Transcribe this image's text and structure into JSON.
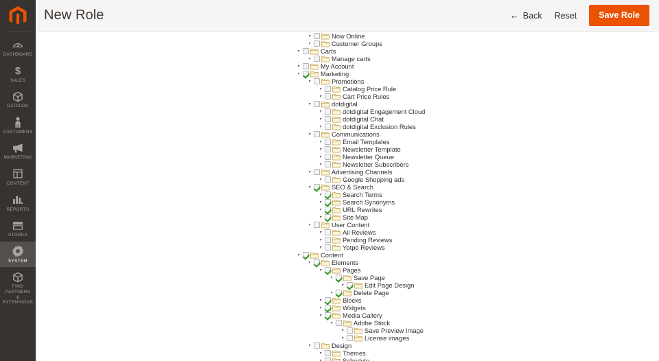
{
  "header": {
    "title": "New Role",
    "back_label": "Back",
    "back_icon": "arrow-left-icon",
    "reset_label": "Reset",
    "save_label": "Save Role",
    "accent_color": "#eb5202",
    "background_color": "#f5f5f5"
  },
  "sidebar": {
    "logo_icon": "magento-logo-icon",
    "logo_color": "#eb5202",
    "background_color": "#373330",
    "active_background_color": "#55504c",
    "items": [
      {
        "label": "Dashboard",
        "icon": "dashboard-icon",
        "active": false
      },
      {
        "label": "Sales",
        "icon": "dollar-icon",
        "active": false
      },
      {
        "label": "Catalog",
        "icon": "box-icon",
        "active": false
      },
      {
        "label": "Customers",
        "icon": "person-icon",
        "active": false
      },
      {
        "label": "Marketing",
        "icon": "megaphone-icon",
        "active": false
      },
      {
        "label": "Content",
        "icon": "layout-icon",
        "active": false
      },
      {
        "label": "Reports",
        "icon": "bar-chart-icon",
        "active": false
      },
      {
        "label": "Stores",
        "icon": "storefront-icon",
        "active": false
      },
      {
        "label": "System",
        "icon": "gear-icon",
        "active": true
      },
      {
        "label": "Find Partners\n& Extensions",
        "icon": "package-icon",
        "active": false
      }
    ]
  },
  "tree": {
    "checked_color": "#3a9e2b",
    "rows": [
      {
        "label": "Now Online",
        "depth": 2,
        "checked": false
      },
      {
        "label": "Customer Groups",
        "depth": 2,
        "checked": false
      },
      {
        "label": "Carts",
        "depth": 1,
        "checked": false
      },
      {
        "label": "Manage carts",
        "depth": 2,
        "checked": false
      },
      {
        "label": "My Account",
        "depth": 1,
        "checked": false
      },
      {
        "label": "Marketing",
        "depth": 1,
        "checked": true
      },
      {
        "label": "Promotions",
        "depth": 2,
        "checked": false
      },
      {
        "label": "Catalog Price Rule",
        "depth": 3,
        "checked": false
      },
      {
        "label": "Cart Price Rules",
        "depth": 3,
        "checked": false
      },
      {
        "label": "dotdigital",
        "depth": 2,
        "checked": false
      },
      {
        "label": "dotdigital Engagement Cloud",
        "depth": 3,
        "checked": false
      },
      {
        "label": "dotdigital Chat",
        "depth": 3,
        "checked": false
      },
      {
        "label": "dotdigital Exclusion Rules",
        "depth": 3,
        "checked": false
      },
      {
        "label": "Communications",
        "depth": 2,
        "checked": false
      },
      {
        "label": "Email Templates",
        "depth": 3,
        "checked": false
      },
      {
        "label": "Newsletter Template",
        "depth": 3,
        "checked": false
      },
      {
        "label": "Newsletter Queue",
        "depth": 3,
        "checked": false
      },
      {
        "label": "Newsletter Subscribers",
        "depth": 3,
        "checked": false
      },
      {
        "label": "Advertising Channels",
        "depth": 2,
        "checked": false
      },
      {
        "label": "Google Shopping ads",
        "depth": 3,
        "checked": false
      },
      {
        "label": "SEO & Search",
        "depth": 2,
        "checked": true
      },
      {
        "label": "Search Terms",
        "depth": 3,
        "checked": true
      },
      {
        "label": "Search Synonyms",
        "depth": 3,
        "checked": true
      },
      {
        "label": "URL Rewrites",
        "depth": 3,
        "checked": true
      },
      {
        "label": "Site Map",
        "depth": 3,
        "checked": true
      },
      {
        "label": "User Content",
        "depth": 2,
        "checked": false
      },
      {
        "label": "All Reviews",
        "depth": 3,
        "checked": false
      },
      {
        "label": "Pending Reviews",
        "depth": 3,
        "checked": false
      },
      {
        "label": "Yotpo Reviews",
        "depth": 3,
        "checked": false
      },
      {
        "label": "Content",
        "depth": 1,
        "checked": true
      },
      {
        "label": "Elements",
        "depth": 2,
        "checked": true
      },
      {
        "label": "Pages",
        "depth": 3,
        "checked": true
      },
      {
        "label": "Save Page",
        "depth": 4,
        "checked": true
      },
      {
        "label": "Edit Page Design",
        "depth": 5,
        "checked": true
      },
      {
        "label": "Delete Page",
        "depth": 4,
        "checked": true
      },
      {
        "label": "Blocks",
        "depth": 3,
        "checked": true
      },
      {
        "label": "Widgets",
        "depth": 3,
        "checked": true
      },
      {
        "label": "Media Gallery",
        "depth": 3,
        "checked": true
      },
      {
        "label": "Adobe Stock",
        "depth": 4,
        "checked": false
      },
      {
        "label": "Save Preview Image",
        "depth": 5,
        "checked": false
      },
      {
        "label": "License images",
        "depth": 5,
        "checked": false
      },
      {
        "label": "Design",
        "depth": 2,
        "checked": false
      },
      {
        "label": "Themes",
        "depth": 3,
        "checked": false
      },
      {
        "label": "Schedule",
        "depth": 3,
        "checked": false
      }
    ]
  }
}
